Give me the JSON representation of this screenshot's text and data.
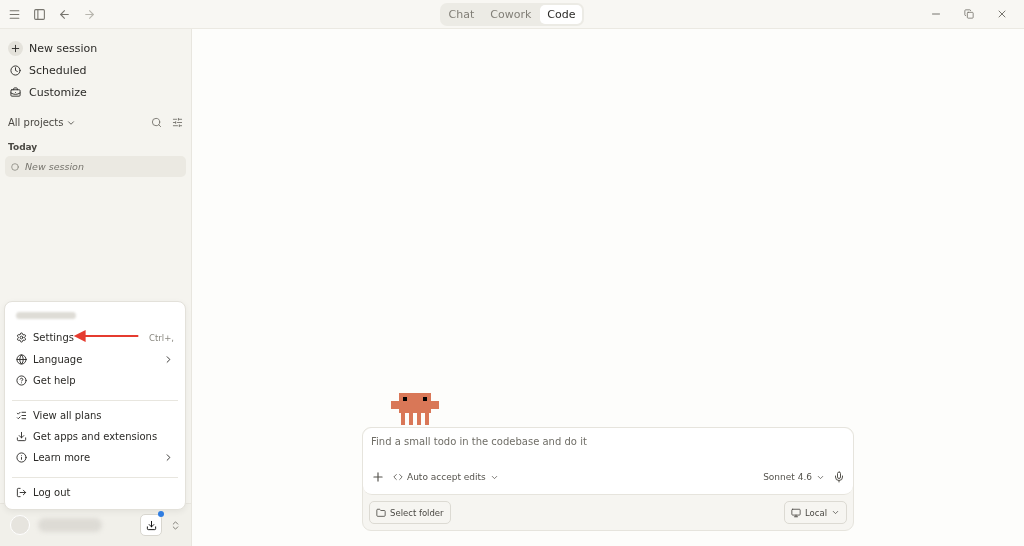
{
  "titlebar": {
    "modes": [
      {
        "label": "Chat",
        "selected": false
      },
      {
        "label": "Cowork",
        "selected": false
      },
      {
        "label": "Code",
        "selected": true
      }
    ]
  },
  "sidebar": {
    "actions": [
      {
        "kind": "new",
        "label": "New session"
      },
      {
        "kind": "scheduled",
        "label": "Scheduled"
      },
      {
        "kind": "customize",
        "label": "Customize"
      }
    ],
    "project_filter": "All projects",
    "section": "Today",
    "sessions": [
      {
        "label": "New session",
        "selected": true
      }
    ]
  },
  "account_menu": {
    "items": [
      {
        "kind": "settings",
        "label": "Settings",
        "shortcut": "Ctrl+,",
        "submenu": false,
        "divider_before": false
      },
      {
        "kind": "language",
        "label": "Language",
        "submenu": true,
        "divider_before": false
      },
      {
        "kind": "help",
        "label": "Get help",
        "submenu": false,
        "divider_before": false
      },
      {
        "kind": "plans",
        "label": "View all plans",
        "submenu": false,
        "divider_before": true
      },
      {
        "kind": "apps",
        "label": "Get apps and extensions",
        "submenu": false,
        "divider_before": false
      },
      {
        "kind": "learn",
        "label": "Learn more",
        "submenu": true,
        "divider_before": false
      },
      {
        "kind": "logout",
        "label": "Log out",
        "submenu": false,
        "divider_before": true
      }
    ]
  },
  "account_bar": {
    "update_available": true
  },
  "composer": {
    "placeholder": "Find a small todo in the codebase and do it",
    "mode": "Auto accept edits",
    "model": "Sonnet 4.6",
    "folder_button": "Select folder",
    "environment": "Local"
  }
}
